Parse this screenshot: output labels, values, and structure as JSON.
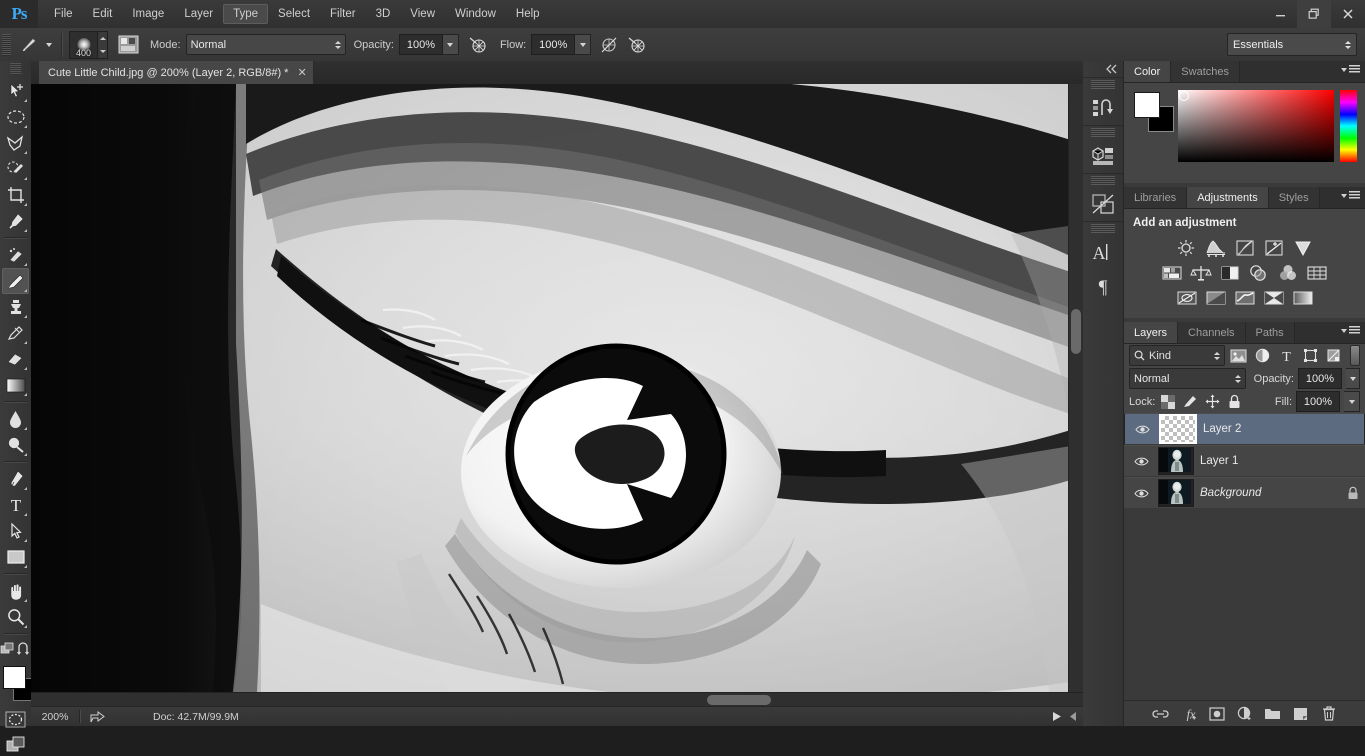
{
  "app": {
    "name": "Adobe Photoshop",
    "logo_text": "Ps"
  },
  "menubar": {
    "items": [
      {
        "label": "File",
        "active": false
      },
      {
        "label": "Edit",
        "active": false
      },
      {
        "label": "Image",
        "active": false
      },
      {
        "label": "Layer",
        "active": false
      },
      {
        "label": "Type",
        "active": true
      },
      {
        "label": "Select",
        "active": false
      },
      {
        "label": "Filter",
        "active": false
      },
      {
        "label": "3D",
        "active": false
      },
      {
        "label": "View",
        "active": false
      },
      {
        "label": "Window",
        "active": false
      },
      {
        "label": "Help",
        "active": false
      }
    ],
    "window_controls": {
      "minimize": "—",
      "restore": "❐",
      "close": "✕"
    }
  },
  "options_bar": {
    "brush_size": "400",
    "mode_label": "Mode:",
    "mode_value": "Normal",
    "opacity_label": "Opacity:",
    "opacity_value": "100%",
    "flow_label": "Flow:",
    "flow_value": "100%",
    "workspace": "Essentials",
    "icons": [
      "brush-preset-icon",
      "brush-panel-icon",
      "airbrush-icon",
      "smoothing-icon",
      "symmetry-icon"
    ]
  },
  "toolbar": {
    "tools": [
      {
        "name": "move-tool",
        "active": false
      },
      {
        "name": "marquee-tool",
        "active": false
      },
      {
        "name": "lasso-tool",
        "active": false
      },
      {
        "name": "quick-selection-tool",
        "active": false
      },
      {
        "name": "crop-tool",
        "active": false
      },
      {
        "name": "eyedropper-tool",
        "active": false
      },
      {
        "name": "healing-brush-tool",
        "active": false
      },
      {
        "name": "brush-tool",
        "active": true
      },
      {
        "name": "clone-stamp-tool",
        "active": false
      },
      {
        "name": "history-brush-tool",
        "active": false
      },
      {
        "name": "eraser-tool",
        "active": false
      },
      {
        "name": "gradient-tool",
        "active": false
      },
      {
        "name": "blur-tool",
        "active": false
      },
      {
        "name": "dodge-tool",
        "active": false
      },
      {
        "name": "pen-tool",
        "active": false
      },
      {
        "name": "type-tool",
        "active": false
      },
      {
        "name": "path-selection-tool",
        "active": false
      },
      {
        "name": "rectangle-tool",
        "active": false
      },
      {
        "name": "hand-tool",
        "active": false
      },
      {
        "name": "zoom-tool",
        "active": false
      }
    ],
    "foreground_color": "#ffffff",
    "background_color": "#000000"
  },
  "document": {
    "tab_title": "Cute Little Child.jpg @ 200% (Layer 2, RGB/8#) *",
    "close_glyph": "✕",
    "image_description": "Grayscale close-up photograph of a child's eye"
  },
  "status_bar": {
    "zoom": "200%",
    "doc_info": "Doc: 42.7M/99.9M"
  },
  "icon_dock": {
    "items": [
      {
        "name": "history-panel-icon"
      },
      {
        "name": "properties-panel-icon"
      },
      {
        "name": "clone-source-panel-icon"
      },
      {
        "name": "character-panel-icon",
        "glyph": "A"
      },
      {
        "name": "paragraph-panel-icon",
        "glyph": "¶"
      }
    ],
    "collapse_glyph": "«"
  },
  "color_panel": {
    "tabs": [
      {
        "label": "Color",
        "active": true
      },
      {
        "label": "Swatches",
        "active": false
      }
    ],
    "foreground": "#ffffff",
    "background": "#000000"
  },
  "adjustments_panel": {
    "tabs": [
      {
        "label": "Libraries",
        "active": false
      },
      {
        "label": "Adjustments",
        "active": true
      },
      {
        "label": "Styles",
        "active": false
      }
    ],
    "title": "Add an adjustment",
    "rows": [
      [
        {
          "name": "brightness-contrast-icon"
        },
        {
          "name": "levels-icon"
        },
        {
          "name": "curves-icon"
        },
        {
          "name": "exposure-icon"
        },
        {
          "name": "vibrance-icon"
        }
      ],
      [
        {
          "name": "hue-saturation-icon"
        },
        {
          "name": "color-balance-icon"
        },
        {
          "name": "black-and-white-icon"
        },
        {
          "name": "photo-filter-icon"
        },
        {
          "name": "channel-mixer-icon"
        },
        {
          "name": "color-lookup-icon"
        }
      ],
      [
        {
          "name": "invert-icon"
        },
        {
          "name": "posterize-icon"
        },
        {
          "name": "threshold-icon"
        },
        {
          "name": "selective-color-icon"
        },
        {
          "name": "gradient-map-icon"
        }
      ]
    ]
  },
  "layers_panel": {
    "tabs": [
      {
        "label": "Layers",
        "active": true
      },
      {
        "label": "Channels",
        "active": false
      },
      {
        "label": "Paths",
        "active": false
      }
    ],
    "filter_kind": "Kind",
    "blend_mode": "Normal",
    "opacity_label": "Opacity:",
    "opacity_value": "100%",
    "lock_label": "Lock:",
    "fill_label": "Fill:",
    "fill_value": "100%",
    "filter_icons": [
      "pixel-filter-icon",
      "adjustment-filter-icon",
      "type-filter-icon",
      "shape-filter-icon",
      "smart-object-filter-icon"
    ],
    "lock_icons": [
      "lock-transparent-pixels-icon",
      "lock-image-pixels-icon",
      "lock-position-icon",
      "lock-all-icon"
    ],
    "layers": [
      {
        "name": "Layer 2",
        "selected": true,
        "visible": true,
        "locked": false,
        "italic": false,
        "thumb": "transparent"
      },
      {
        "name": "Layer 1",
        "selected": false,
        "visible": true,
        "locked": false,
        "italic": false,
        "thumb": "photo"
      },
      {
        "name": "Background",
        "selected": false,
        "visible": true,
        "locked": true,
        "italic": true,
        "thumb": "photo"
      }
    ],
    "footer_icons": [
      {
        "name": "link-layers-icon"
      },
      {
        "name": "layer-style-fx-icon",
        "glyph": "fx"
      },
      {
        "name": "add-layer-mask-icon"
      },
      {
        "name": "new-fill-adjustment-layer-icon"
      },
      {
        "name": "new-group-icon"
      },
      {
        "name": "new-layer-icon"
      },
      {
        "name": "delete-layer-icon"
      }
    ]
  },
  "colors": {
    "panel_bg": "#454545",
    "chrome_bg": "#3a3a3a",
    "selection_blue": "#5d6b80",
    "accent": "#3fa9f5"
  }
}
